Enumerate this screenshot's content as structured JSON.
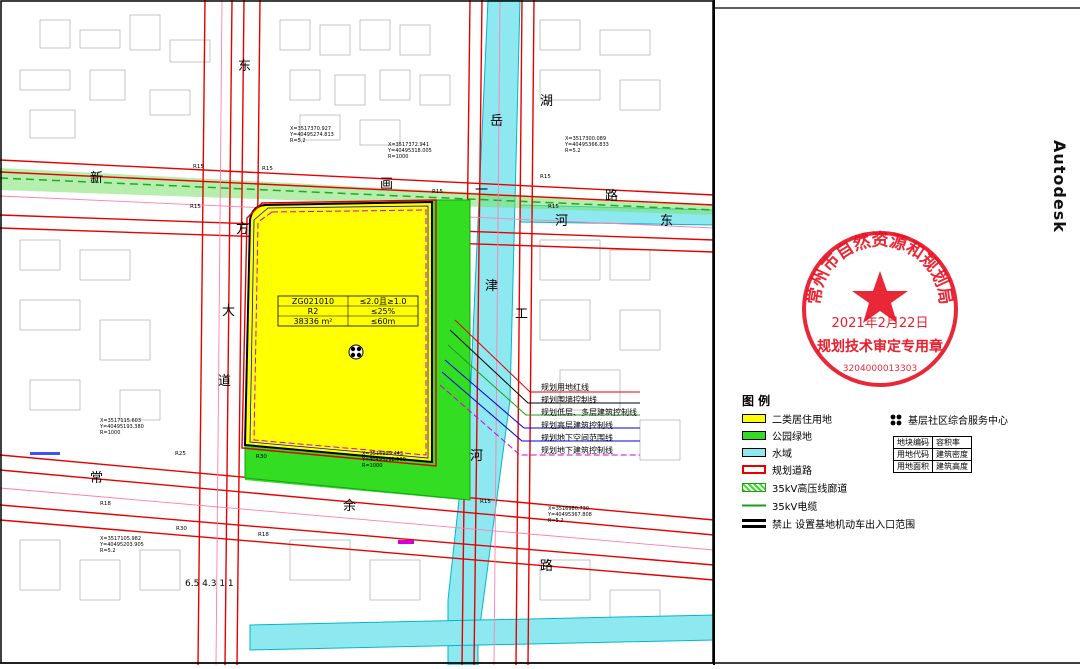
{
  "map": {
    "street_labels": [
      "东",
      "方",
      "大",
      "道",
      "新",
      "画",
      "一",
      "路",
      "岳",
      "津",
      "河",
      "湖",
      "东",
      "河",
      "常",
      "余",
      "路",
      "工"
    ],
    "parcel_table": {
      "rows": [
        [
          "ZG021010",
          "≤2.0且≥1.0"
        ],
        [
          "R2",
          "≤25%"
        ],
        [
          "38336 m²",
          "≤60m"
        ]
      ]
    },
    "coordinates": [
      "X=3517370.927\nY=40495274.813\nR=5.2",
      "X=3517372.941\nY=40495318.005\nR=1000",
      "X=3517300.089\nY=40495366.833\nR=5.2",
      "X=3517115.603\nY=40495193.380\nR=1000",
      "X=3516999.443\nY=40495292.560\nR=1000",
      "X=3516980.730\nY=40495367.808\nR=5.2",
      "X=3517105.982\nY=40495203.905\nR=5.2"
    ],
    "road_radius_labels": [
      "R15",
      "R15",
      "R15",
      "R15",
      "R15",
      "R15",
      "R18",
      "R18",
      "R25",
      "R30",
      "R30",
      "R15"
    ],
    "scale_label": "6.5   4.3   1   1",
    "callouts": [
      "规划用地红线",
      "规划围墙控制线",
      "规划低层、多层建筑控制线",
      "规划高层建筑控制线",
      "规划地下空间范围线",
      "规划地下建筑控制线"
    ],
    "callout_colors": [
      "#e00000",
      "#000000",
      "#1a9e1a",
      "#0000dd",
      "#0000dd",
      "#d400d4"
    ],
    "colors": {
      "residential": "#ffff00",
      "park": "#33dd22",
      "water": "#8ee8f0",
      "road_red": "#e60000",
      "road_pink": "#ff7fb0"
    }
  },
  "legend": {
    "title": "图 例",
    "items": [
      {
        "label": "二类居住用地",
        "icon": "yellow-swatch"
      },
      {
        "label": "公园绿地",
        "icon": "green-swatch"
      },
      {
        "label": "水域",
        "icon": "cyan-swatch"
      },
      {
        "label": "规划道路",
        "icon": "road-swatch"
      },
      {
        "label": "35kV高压线廊道",
        "icon": "hv-corridor-swatch"
      },
      {
        "label": "35kV电缆",
        "icon": "cable-swatch"
      },
      {
        "label": "禁止 设置基地机动车出入口范围",
        "icon": "no-entrance-swatch"
      }
    ],
    "service_center": "基层社区综合服务中心",
    "index_table": [
      [
        "地块编码",
        "容积率"
      ],
      [
        "用地代码",
        "建筑密度"
      ],
      [
        "用地面积",
        "建筑高度"
      ]
    ]
  },
  "stamp": {
    "arc_text": "常州市自然资源和规划局",
    "date": "2021年2月22日",
    "purpose": "规划技术审定专用章",
    "number": "3204000013303"
  },
  "side_watermark": "Autodesk"
}
